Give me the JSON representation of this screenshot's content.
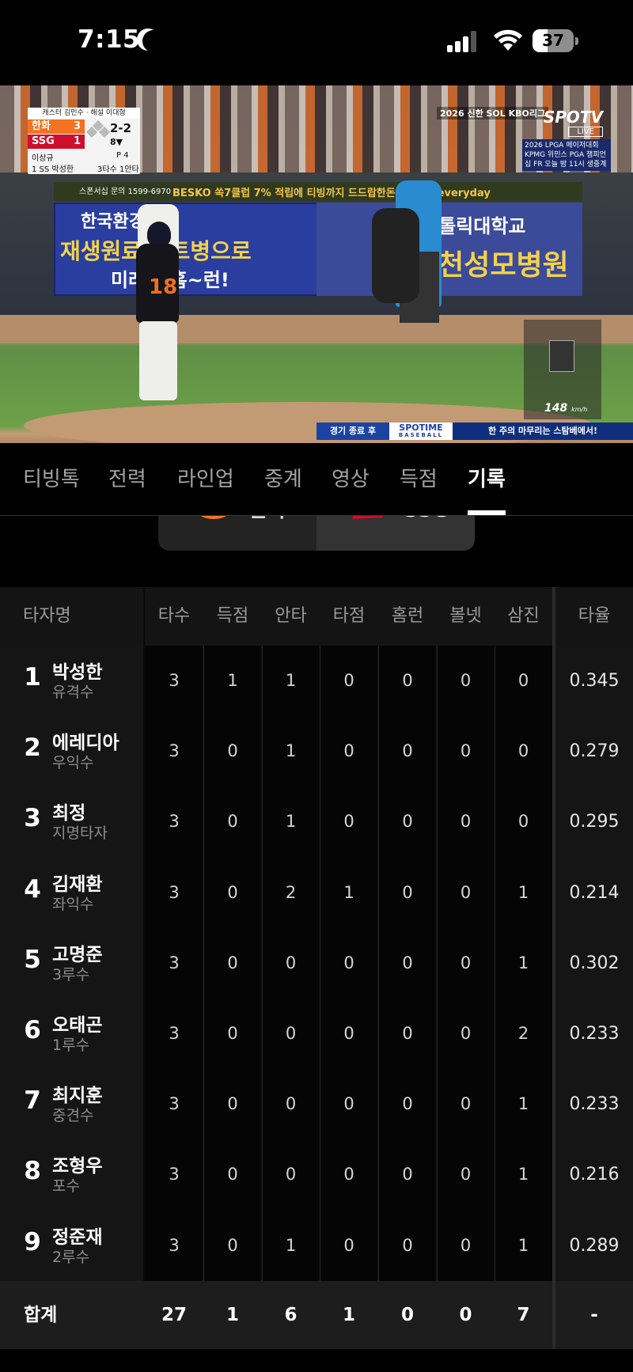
{
  "status": {
    "time": "7:15",
    "battery": "37",
    "battery_level": 0.37
  },
  "video": {
    "scorebug": {
      "caster": "캐스터 김민수 · 해설 이대형",
      "team1": "한화",
      "score1": "3",
      "team2": "SSG",
      "score2": "1",
      "count": "2-2",
      "inning": "8▼",
      "pitcher": "이상규",
      "pitcher_tag": "P  4",
      "batter": "1 SS 박성한",
      "batter_result": "3타수 1안타"
    },
    "kbo": "2026 신한 SOL KBO리그",
    "spotv": "SPOTV",
    "live": "LIVE",
    "spotv_info": "2026 LPGA 메이저대회 KPMG 위민스 PGA 챔피언십 FR 오늘 밤 11시 생중계",
    "jersey_number": "18",
    "ad_line1": "한국환경공단",
    "ad_line2": "재생원료 페트병으로",
    "ad_line3": "미래에 홈~런!",
    "ad_right1": "가톨릭대학교",
    "ad_right2": "인천성모병원",
    "ad_strip": "BESKO  쏙7클럽 7%  적립에 티빙까지  드드랍한돈  emart everyday",
    "sponsor": "스폰서십 문의 1599-6970",
    "pitch_speed": "148",
    "pitch_unit": "km/h",
    "ticker_a": "경기 종료 후",
    "ticker_b": "SPOTIME",
    "ticker_b_sub": "BASEBALL",
    "ticker_c": "한 주의 마무리는 스탐베에서!"
  },
  "tabs": [
    {
      "label": "티빙톡"
    },
    {
      "label": "전력"
    },
    {
      "label": "라인업"
    },
    {
      "label": "중계"
    },
    {
      "label": "영상"
    },
    {
      "label": "득점"
    },
    {
      "label": "기록",
      "active": true
    }
  ],
  "team_switch": {
    "team1": "한화",
    "team2": "SSG",
    "selected": "SSG"
  },
  "table": {
    "headers": [
      "타자명",
      "타수",
      "득점",
      "안타",
      "타점",
      "홈런",
      "볼넷",
      "삼진",
      "타율"
    ],
    "rows": [
      {
        "order": "1",
        "name": "박성한",
        "pos": "유격수",
        "stats": [
          "3",
          "1",
          "1",
          "0",
          "0",
          "0",
          "0"
        ],
        "avg": "0.345"
      },
      {
        "order": "2",
        "name": "에레디아",
        "pos": "우익수",
        "stats": [
          "3",
          "0",
          "1",
          "0",
          "0",
          "0",
          "0"
        ],
        "avg": "0.279"
      },
      {
        "order": "3",
        "name": "최정",
        "pos": "지명타자",
        "stats": [
          "3",
          "0",
          "1",
          "0",
          "0",
          "0",
          "0"
        ],
        "avg": "0.295"
      },
      {
        "order": "4",
        "name": "김재환",
        "pos": "좌익수",
        "stats": [
          "3",
          "0",
          "2",
          "1",
          "0",
          "0",
          "1"
        ],
        "avg": "0.214"
      },
      {
        "order": "5",
        "name": "고명준",
        "pos": "3루수",
        "stats": [
          "3",
          "0",
          "0",
          "0",
          "0",
          "0",
          "1"
        ],
        "avg": "0.302"
      },
      {
        "order": "6",
        "name": "오태곤",
        "pos": "1루수",
        "stats": [
          "3",
          "0",
          "0",
          "0",
          "0",
          "0",
          "2"
        ],
        "avg": "0.233"
      },
      {
        "order": "7",
        "name": "최지훈",
        "pos": "중견수",
        "stats": [
          "3",
          "0",
          "0",
          "0",
          "0",
          "0",
          "1"
        ],
        "avg": "0.233"
      },
      {
        "order": "8",
        "name": "조형우",
        "pos": "포수",
        "stats": [
          "3",
          "0",
          "0",
          "0",
          "0",
          "0",
          "1"
        ],
        "avg": "0.216"
      },
      {
        "order": "9",
        "name": "정준재",
        "pos": "2루수",
        "stats": [
          "3",
          "0",
          "1",
          "0",
          "0",
          "0",
          "1"
        ],
        "avg": "0.289"
      }
    ],
    "total": {
      "label": "합계",
      "stats": [
        "27",
        "1",
        "6",
        "1",
        "0",
        "0",
        "7"
      ],
      "avg": "-"
    }
  },
  "colors": {
    "hanwha": "#f37321",
    "ssg": "#ce0e2d",
    "background": "#000000"
  }
}
